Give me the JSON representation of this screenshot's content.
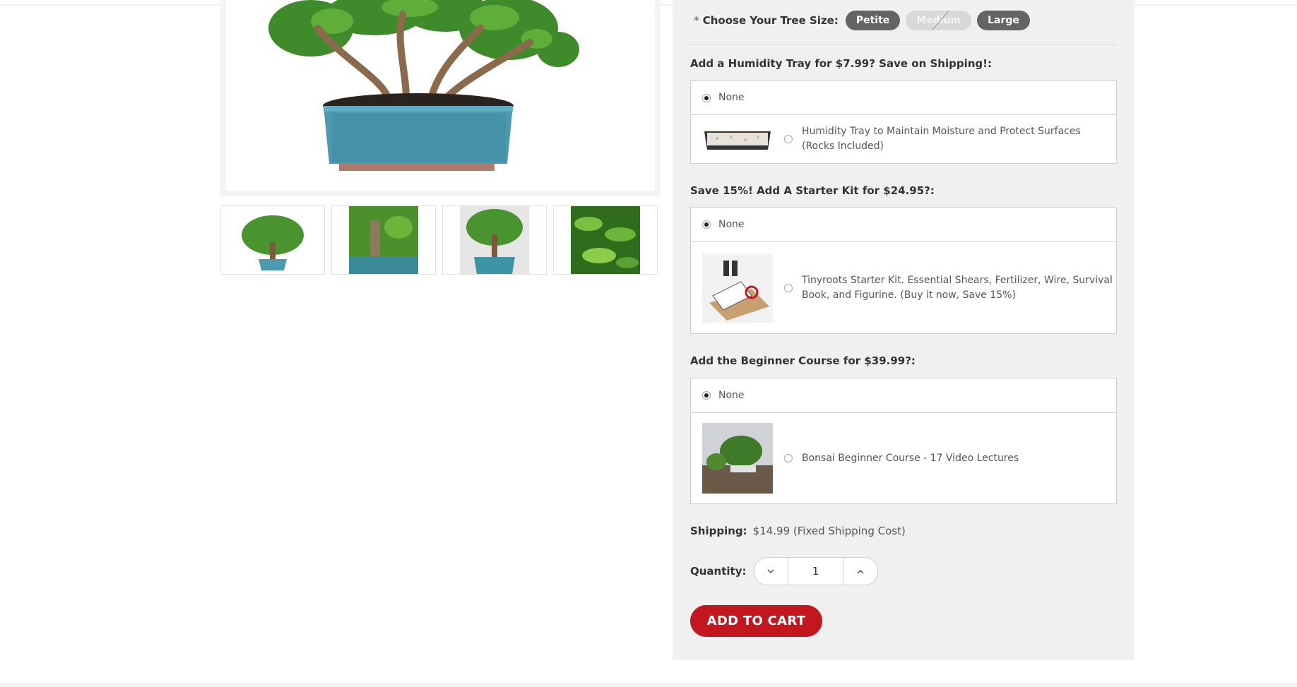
{
  "product": {
    "size_option": {
      "label": "Choose Your Tree Size:",
      "required_mark": "*",
      "options": [
        "Petite",
        "Medium",
        "Large"
      ],
      "disabled": "Medium"
    },
    "humidity_tray": {
      "title": "Add a Humidity Tray for $7.99? Save on Shipping!:",
      "none_label": "None",
      "option_label": "Humidity Tray to Maintain Moisture and Protect Surfaces (Rocks Included)"
    },
    "starter_kit": {
      "title": "Save 15%! Add A Starter Kit for $24.95?:",
      "none_label": "None",
      "option_label": "Tinyroots Starter Kit. Essential Shears, Fertilizer, Wire, Survival Book, and Figurine. (Buy it now, Save 15%)"
    },
    "course": {
      "title": "Add the Beginner Course for $39.99?:",
      "none_label": "None",
      "option_label": "Bonsai Beginner Course - 17 Video Lectures"
    },
    "shipping": {
      "label": "Shipping:",
      "value": "$14.99 (Fixed Shipping Cost)"
    },
    "quantity": {
      "label": "Quantity:",
      "value": "1",
      "decrement_icon": "chevron-down-icon",
      "increment_icon": "chevron-up-icon"
    },
    "add_to_cart_label": "ADD TO CART"
  },
  "gallery": {
    "thumbnails": [
      "bonsai-full-view",
      "bonsai-trunk-closeup",
      "bonsai-front-view",
      "bonsai-leaves-closeup"
    ]
  },
  "colors": {
    "accent": "#c3171f",
    "size_selected_bg": "#646464",
    "panel_bg": "#f0f0f0"
  }
}
